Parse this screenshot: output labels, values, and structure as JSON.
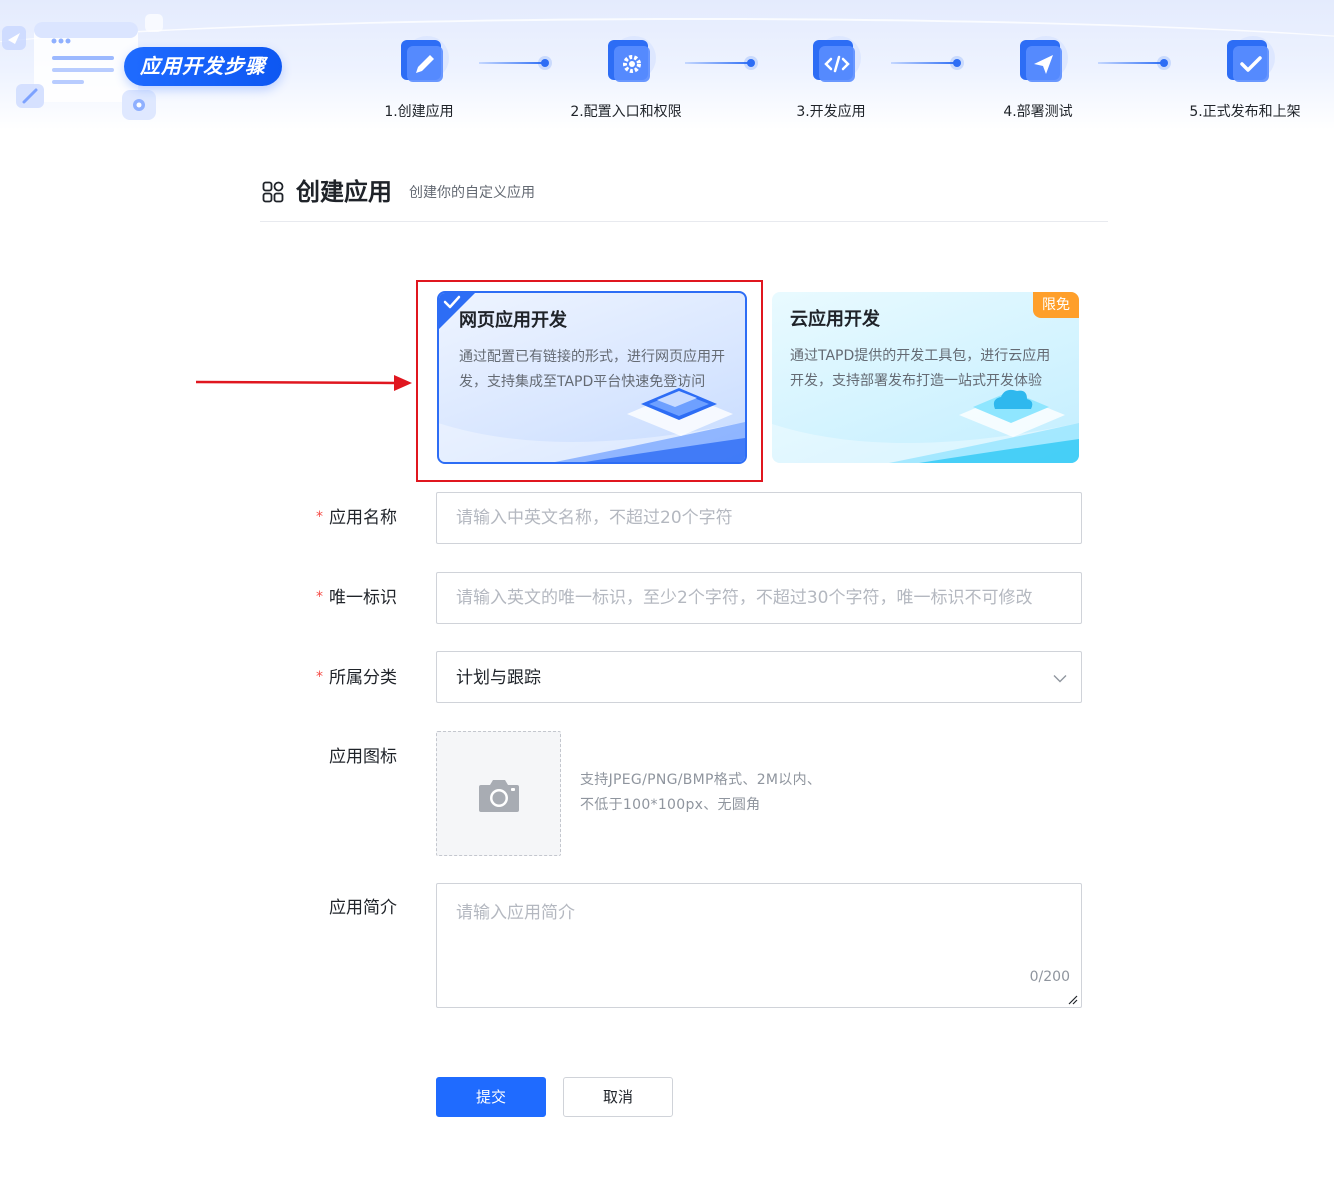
{
  "header": {
    "badge": "应用开发步骤",
    "steps": [
      {
        "label": "1.创建应用",
        "icon": "pencil-icon"
      },
      {
        "label": "2.配置入口和权限",
        "icon": "gear-icon"
      },
      {
        "label": "3.开发应用",
        "icon": "code-icon"
      },
      {
        "label": "4.部署测试",
        "icon": "paper-plane-icon"
      },
      {
        "label": "5.正式发布和上架",
        "icon": "checkmark-icon"
      }
    ]
  },
  "section": {
    "title": "创建应用",
    "subtitle": "创建你的自定义应用"
  },
  "cards": {
    "web": {
      "title": "网页应用开发",
      "desc": "通过配置已有链接的形式，进行网页应用开发，支持集成至TAPD平台快速免登访问",
      "selected": true
    },
    "cloud": {
      "title": "云应用开发",
      "desc": "通过TAPD提供的开发工具包，进行云应用开发，支持部署发布打造一站式开发体验",
      "badge": "限免"
    }
  },
  "form": {
    "required_mark": "*",
    "name": {
      "label": "应用名称",
      "placeholder": "请输入中英文名称，不超过20个字符"
    },
    "identifier": {
      "label": "唯一标识",
      "placeholder": "请输入英文的唯一标识，至少2个字符，不超过30个字符，唯一标识不可修改"
    },
    "category": {
      "label": "所属分类",
      "value": "计划与跟踪"
    },
    "icon": {
      "label": "应用图标",
      "hint_line1": "支持JPEG/PNG/BMP格式、2M以内、",
      "hint_line2": "不低于100*100px、无圆角"
    },
    "intro": {
      "label": "应用简介",
      "placeholder": "请输入应用简介",
      "counter": "0/200"
    },
    "submit": "提交",
    "cancel": "取消"
  },
  "colors": {
    "primary": "#1f6bff",
    "annotation": "#e0161f",
    "badge": "#ff9f2a",
    "required": "#f54a45"
  }
}
